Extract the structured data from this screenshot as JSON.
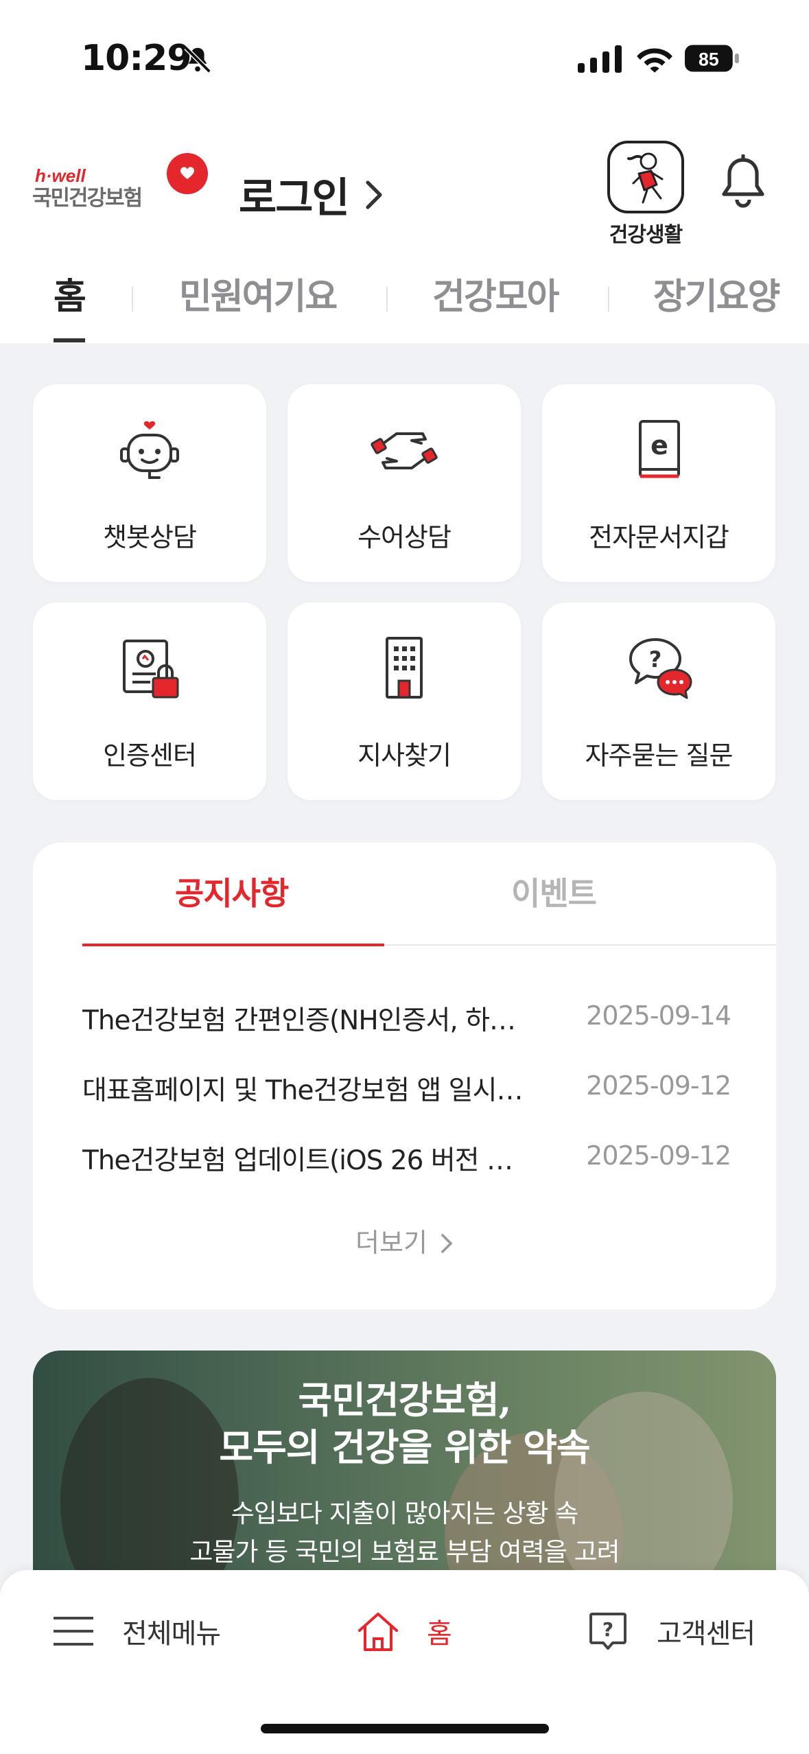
{
  "status_bar": {
    "time": "10:29",
    "battery": "85"
  },
  "header": {
    "logo_tagline": "h·well",
    "logo_name": "국민건강보험",
    "login_label": "로그인",
    "health_life_label": "건강생활"
  },
  "tabs": [
    {
      "label": "홈",
      "active": true
    },
    {
      "label": "민원여기요"
    },
    {
      "label": "건강모아"
    },
    {
      "label": "장기요양"
    }
  ],
  "quick_menu": [
    {
      "label": "챗봇상담",
      "icon": "chatbot-icon"
    },
    {
      "label": "수어상담",
      "icon": "sign-language-icon"
    },
    {
      "label": "전자문서지갑",
      "icon": "e-document-icon"
    },
    {
      "label": "인증센터",
      "icon": "certificate-lock-icon"
    },
    {
      "label": "지사찾기",
      "icon": "building-icon"
    },
    {
      "label": "자주묻는 질문",
      "icon": "faq-bubbles-icon"
    }
  ],
  "notice_board": {
    "tabs": {
      "notice": "공지사항",
      "event": "이벤트"
    },
    "items": [
      {
        "title": "The건강보험 간편인증(NH인증서, 하…",
        "date": "2025-09-14"
      },
      {
        "title": "대표홈페이지 및 The건강보험 앱 일시…",
        "date": "2025-09-12"
      },
      {
        "title": "The건강보험 업데이트(iOS 26 버전 …",
        "date": "2025-09-12"
      }
    ],
    "more_label": "더보기"
  },
  "banner": {
    "headline_1": "국민건강보험,",
    "headline_2": "모두의 건강을 위한 약속",
    "sub_1": "수입보다 지출이 많아지는 상황 속",
    "sub_2": "고물가 등 국민의 보험료 부담 여력을 고려"
  },
  "bottom_nav": {
    "menu": "전체메뉴",
    "home": "홈",
    "support": "고객센터"
  },
  "colors": {
    "brand_red": "#E4262D",
    "background": "#F1F2F6"
  }
}
